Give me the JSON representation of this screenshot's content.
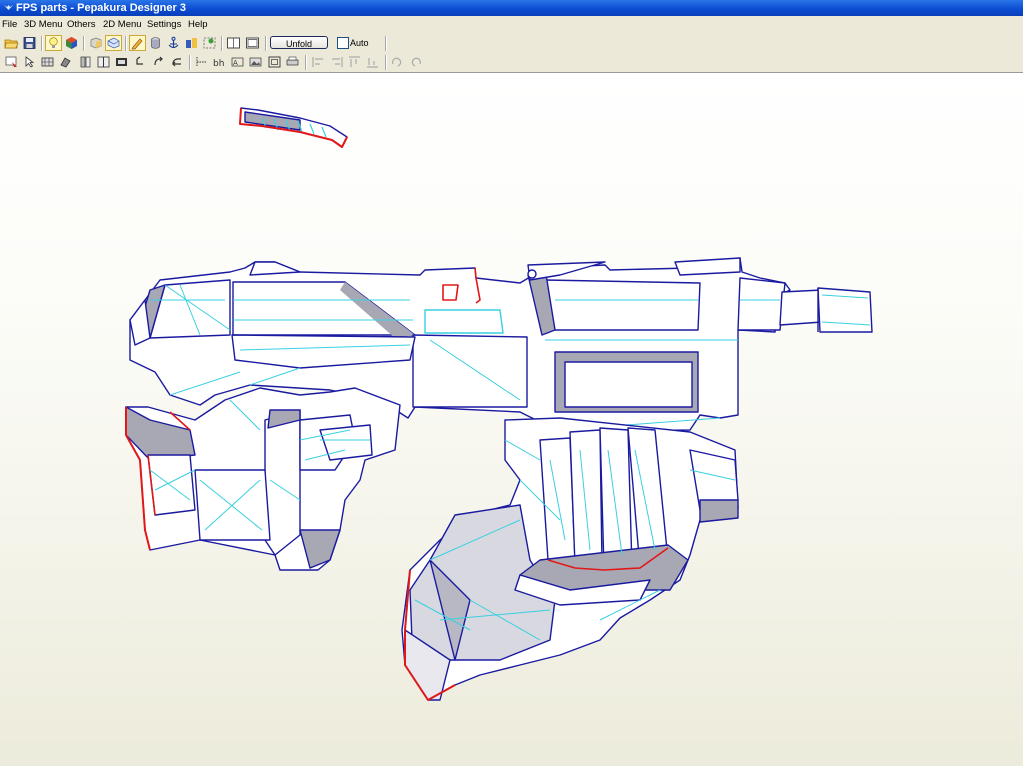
{
  "window": {
    "title": "FPS parts - Pepakura Designer 3"
  },
  "menu": {
    "items": [
      "File",
      "3D Menu",
      "Others",
      "2D Menu",
      "Settings",
      "Help"
    ]
  },
  "toolbar": {
    "unfold_label": "Unfold",
    "auto_label": "Auto",
    "auto_checked": false
  },
  "colors": {
    "edge_blue": "#1a1aa0",
    "fold_cyan": "#39d0e0",
    "cut_red": "#e01818",
    "face_white": "#ffffff",
    "face_gray": "#a8a8b4"
  }
}
